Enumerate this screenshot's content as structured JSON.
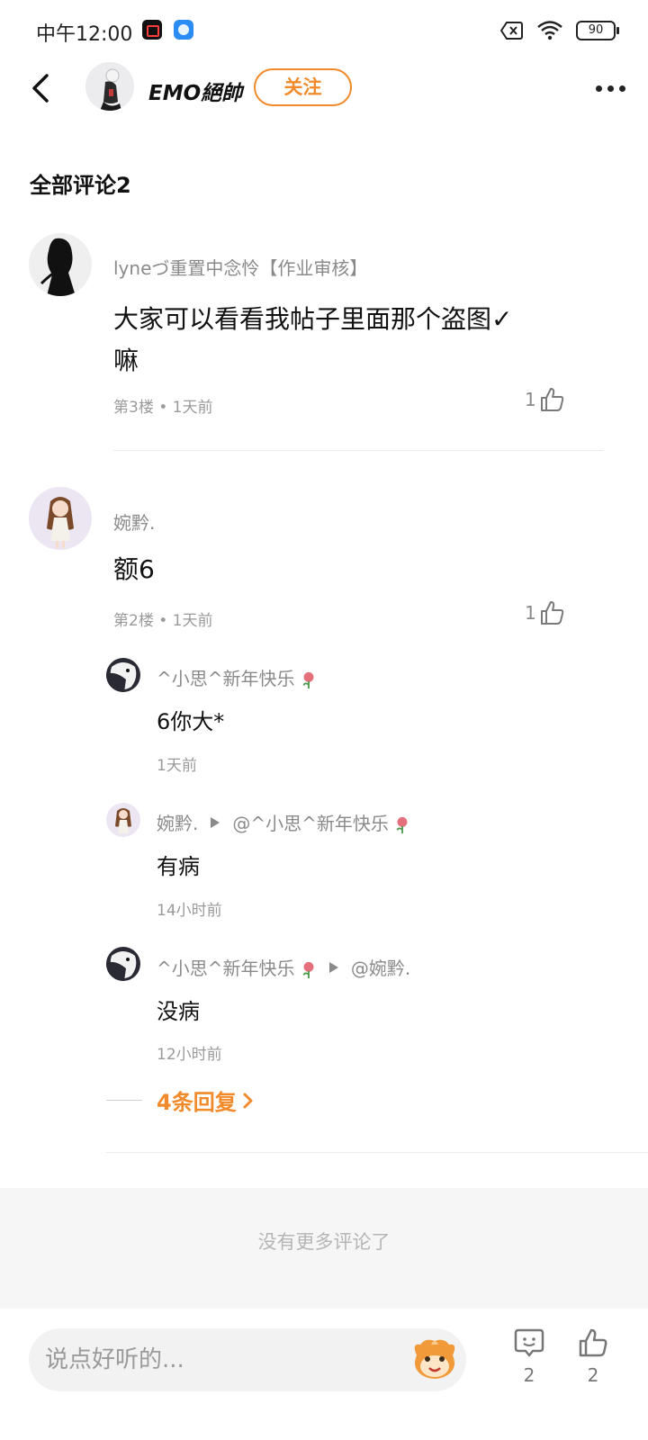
{
  "status_bar": {
    "time": "中午12:00",
    "battery": "90"
  },
  "header": {
    "author_name": "EMO絕帥",
    "follow_label": "关注"
  },
  "comments_section": {
    "title": "全部评论2"
  },
  "comments": [
    {
      "name": "lyneづ重置中念怜【作业审核】",
      "text_line1": "大家可以看看我帖子里面那个盗图✓",
      "text_line2": "嘛",
      "floor": "第3楼",
      "time": "1天前",
      "likes": "1"
    },
    {
      "name": "婉黔.",
      "text": "额6",
      "floor": "第2楼",
      "time": "1天前",
      "likes": "1",
      "replies": [
        {
          "name": "^小思^新年快乐",
          "target": "",
          "text": "6你大*",
          "time": "1天前"
        },
        {
          "name": "婉黔.",
          "target": "@^小思^新年快乐",
          "text": "有病",
          "time": "14小时前"
        },
        {
          "name": "^小思^新年快乐",
          "target": "@婉黔.",
          "text": "没病",
          "time": "12小时前"
        }
      ],
      "more_replies_label": "4条回复"
    }
  ],
  "meta_separator": "•",
  "no_more_text": "没有更多评论了",
  "bottom_bar": {
    "input_placeholder": "说点好听的...",
    "comment_count": "2",
    "like_count": "2"
  },
  "colors": {
    "accent": "#f08a2b",
    "text_primary": "#111111",
    "text_secondary": "#8a8a8a"
  }
}
